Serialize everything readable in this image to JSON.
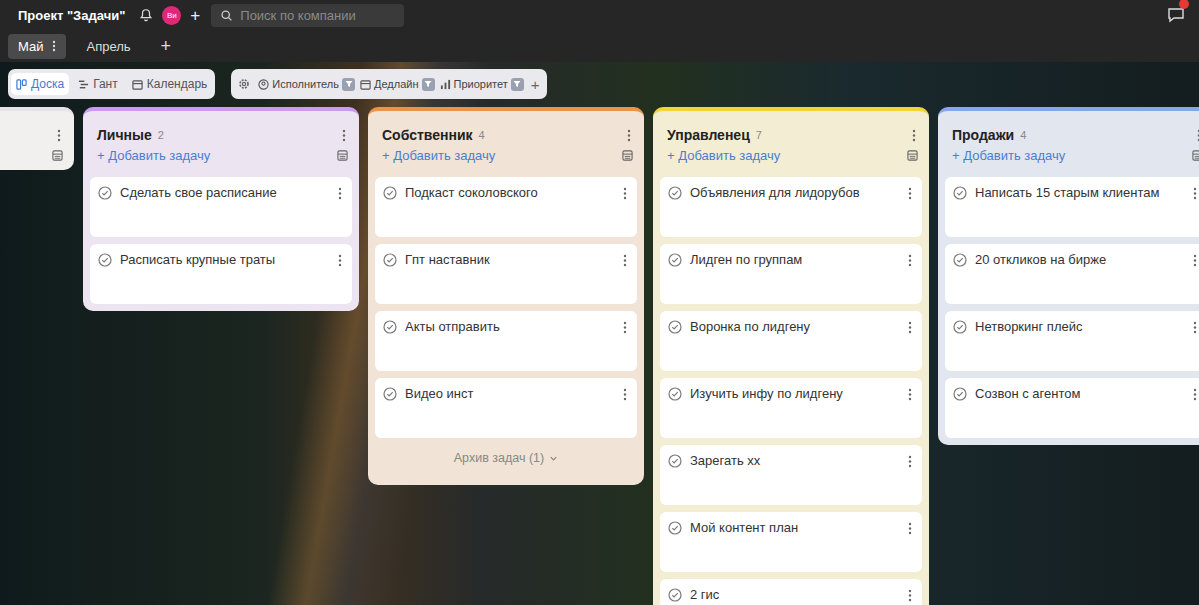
{
  "header": {
    "title": "Проект \"Задачи\"",
    "avatar": "Ви",
    "add": "+",
    "search": {
      "placeholder": "Поиск по компании"
    },
    "chat": {
      "has_unread": true
    }
  },
  "tabs": [
    {
      "label": "Май",
      "selected": true
    },
    {
      "label": "Апрель",
      "selected": false
    }
  ],
  "add_tab": "+",
  "views": [
    {
      "label": "Доска",
      "kind": "board",
      "selected": true
    },
    {
      "label": "Гант",
      "kind": "gantt",
      "selected": false
    },
    {
      "label": "Календарь",
      "kind": "calendar",
      "selected": false
    }
  ],
  "filters": [
    {
      "label": "Исполнитель",
      "kind": "user"
    },
    {
      "label": "Дедлайн",
      "kind": "deadline"
    },
    {
      "label": "Приоритет",
      "kind": "priority"
    }
  ],
  "add_filter": "+",
  "add_task_label": "+ Добавить задачу",
  "columns": [
    {
      "title": "",
      "count": "",
      "color": "#e4e4e8",
      "tasks": [],
      "archive": ""
    },
    {
      "title": "Личные",
      "count": "2",
      "color": "#c99cf0",
      "tasks": [
        "Сделать свое расписание",
        "Расписать крупные траты"
      ],
      "archive": ""
    },
    {
      "title": "Собственник",
      "count": "4",
      "color": "#e8944a",
      "tasks": [
        "Подкаст соколовского",
        "Гпт наставник",
        "Акты отправить",
        "Видео инст"
      ],
      "archive": "Архив задач (1)"
    },
    {
      "title": "Управленец",
      "count": "7",
      "color": "#f3d23c",
      "tasks": [
        "Объявления для лидорубов",
        "Лидген по группам",
        "Воронка по лидгену",
        "Изучить инфу по лидгену",
        "Зарегать хх",
        "Мой контент план",
        "2 гис"
      ],
      "archive": ""
    },
    {
      "title": "Продажи",
      "count": "4",
      "color": "#88a6ec",
      "tasks": [
        "Написать 15 старым клиентам",
        "20 откликов на бирже",
        "Нетворкинг плейс",
        "Созвон с агентом"
      ],
      "archive": ""
    }
  ]
}
